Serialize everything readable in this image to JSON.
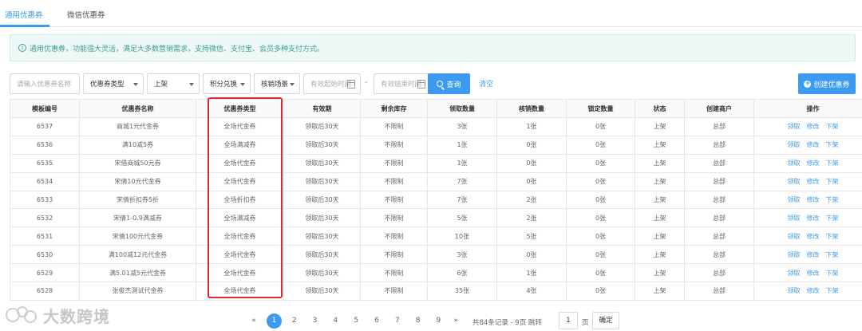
{
  "tabs": [
    {
      "label": "通用优惠券",
      "active": true
    },
    {
      "label": "微信优惠券",
      "active": false
    }
  ],
  "notice": {
    "icon": "info-icon",
    "text": "通用优惠券，功能强大灵活，满足大多数营销需求，支持微信、支付宝、会员多种支付方式。"
  },
  "filters": {
    "name_placeholder": "请输入优惠券名称",
    "coupon_type": "优惠券类型",
    "status": "上架",
    "points_exchange": "积分兑换",
    "usage_scene": "核销场景",
    "start_placeholder": "有效起始时间",
    "end_placeholder": "有效结束时间",
    "separator": "-"
  },
  "actions": {
    "query": "查询",
    "clear": "清空",
    "create": "创建优惠券"
  },
  "table": {
    "columns": [
      "模板编号",
      "优惠券名称",
      "优惠券类型",
      "有效期",
      "剩余库存",
      "领取数量",
      "核销数量",
      "锁定数量",
      "状态",
      "创建商户",
      "操作"
    ],
    "rows": [
      [
        "6537",
        "商城1元代金券",
        "全场代金券",
        "领取后30天",
        "不限制",
        "3张",
        "1张",
        "0张",
        "上架",
        "总部"
      ],
      [
        "6536",
        "满10减5券",
        "全场满减券",
        "领取后30天",
        "不限制",
        "1张",
        "0张",
        "0张",
        "上架",
        "总部"
      ],
      [
        "6535",
        "宋借商城50元券",
        "全场代金券",
        "领取后30天",
        "不限制",
        "1张",
        "0张",
        "0张",
        "上架",
        "总部"
      ],
      [
        "6534",
        "宋倩10元代金券",
        "全场代金券",
        "领取后30天",
        "不限制",
        "7张",
        "0张",
        "0张",
        "上架",
        "总部"
      ],
      [
        "6533",
        "宋倩折扣券5折",
        "全场折扣券",
        "领取后30天",
        "不限制",
        "7张",
        "2张",
        "0张",
        "上架",
        "总部"
      ],
      [
        "6532",
        "宋倩1-0.9满减券",
        "全场满减券",
        "领取后30天",
        "不限制",
        "5张",
        "2张",
        "0张",
        "上架",
        "总部"
      ],
      [
        "6531",
        "宋倩100元代金券",
        "全场代金券",
        "领取后30天",
        "不限制",
        "10张",
        "5张",
        "0张",
        "上架",
        "总部"
      ],
      [
        "6530",
        "满100减12元代金券",
        "全场代金券",
        "领取后30天",
        "不限制",
        "3张",
        "0张",
        "0张",
        "上架",
        "总部"
      ],
      [
        "6529",
        "满5.01减5元代金券",
        "全场代金券",
        "领取后30天",
        "不限制",
        "6张",
        "1张",
        "0张",
        "上架",
        "总部"
      ],
      [
        "6528",
        "张俊杰测试代金券",
        "全场代金券",
        "领取后30天",
        "不限制",
        "35张",
        "4张",
        "0张",
        "上架",
        "总部"
      ]
    ],
    "row_actions": [
      "领取",
      "修改",
      "下架"
    ]
  },
  "pagination": {
    "prev": "«",
    "next": "»",
    "pages": [
      "1",
      "2",
      "3",
      "4",
      "5",
      "6",
      "7",
      "8",
      "9"
    ],
    "current": "1",
    "info": "共84条记录 - 9页 跳转",
    "jump_value": "1",
    "unit": "页",
    "go": "确定"
  },
  "watermark": {
    "text": "大数跨境"
  },
  "colors": {
    "accent": "#3c9bf0",
    "highlight": "#d62c2c",
    "notice_bg": "#eef8f6",
    "notice_text": "#3d9f8c"
  }
}
